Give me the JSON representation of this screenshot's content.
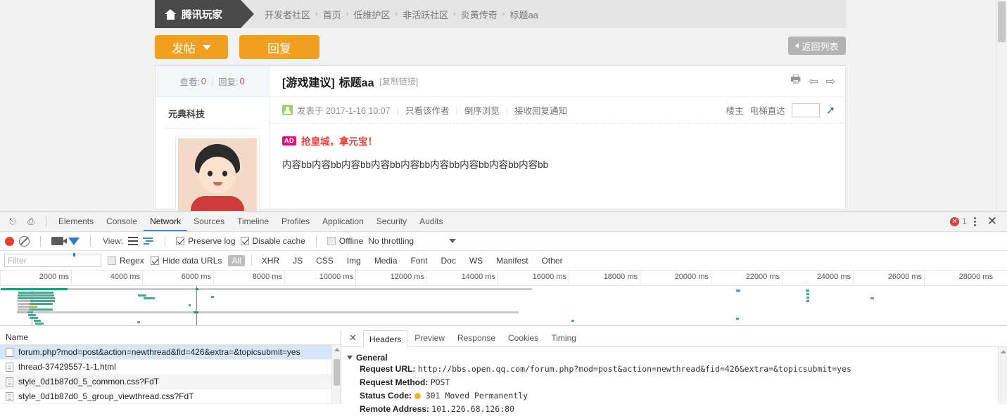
{
  "forum": {
    "brand": "腾讯玩家",
    "breadcrumb": [
      {
        "label": "开发者社区"
      },
      {
        "label": "首页"
      },
      {
        "label": "低维护区"
      },
      {
        "label": "非活跃社区"
      },
      {
        "label": "炎黄传奇"
      },
      {
        "label": "标题aa"
      }
    ],
    "buttons": {
      "post": "发帖",
      "reply": "回复",
      "back": "返回列表"
    },
    "stats": {
      "views_label": "查看:",
      "views_value": "0",
      "replies_label": "回复:",
      "replies_value": "0"
    },
    "author": "元典科技",
    "thread": {
      "category": "[游戏建议]",
      "title": "标题aa",
      "copy_link": "[复制链接]",
      "posted_at": "发表于 2017-1-16 10:07",
      "links": [
        "只看该作者",
        "倒序浏览",
        "接收回复通知"
      ],
      "floor_label": "楼主",
      "elevator_label": "电梯直达",
      "floor_value": "",
      "ad_badge": "AD",
      "ad_text": "抢皇城，拿元宝！",
      "content": "内容bb内容bb内容bb内容bb内容bb内容bb内容bb内容bb内容bb"
    },
    "icons": {
      "print": "print-icon",
      "prev": "prev-arrow-icon",
      "next": "next-arrow-icon",
      "jump": "jump-wrench-icon"
    }
  },
  "devtools": {
    "tabs": [
      "Elements",
      "Console",
      "Network",
      "Sources",
      "Timeline",
      "Profiles",
      "Application",
      "Security",
      "Audits"
    ],
    "active_tab": "Network",
    "error_count": "1",
    "toolbar": {
      "view_label": "View:",
      "preserve_log": "Preserve log",
      "preserve_log_checked": true,
      "disable_cache": "Disable cache",
      "disable_cache_checked": true,
      "offline": "Offline",
      "offline_checked": false,
      "throttling": "No throttling"
    },
    "filterbar": {
      "placeholder": "Filter",
      "value": "",
      "regex": "Regex",
      "regex_checked": false,
      "hide_data_urls": "Hide data URLs",
      "hide_data_urls_checked": true,
      "types": [
        "All",
        "XHR",
        "JS",
        "CSS",
        "Img",
        "Media",
        "Font",
        "Doc",
        "WS",
        "Manifest",
        "Other"
      ],
      "active_type": "All"
    },
    "timeline_ticks": [
      "2000 ms",
      "4000 ms",
      "6000 ms",
      "8000 ms",
      "10000 ms",
      "12000 ms",
      "14000 ms",
      "16000 ms",
      "18000 ms",
      "20000 ms",
      "22000 ms",
      "24000 ms",
      "26000 ms",
      "28000 ms"
    ],
    "requests": {
      "column_name": "Name",
      "rows": [
        {
          "name": "forum.php?mod=post&action=newthread&fid=426&extra=&topicsubmit=yes",
          "selected": true
        },
        {
          "name": "thread-37429557-1-1.html",
          "selected": false
        },
        {
          "name": "style_0d1b87d0_5_common.css?FdT",
          "selected": false
        },
        {
          "name": "style_0d1b87d0_5_group_viewthread.css?FdT",
          "selected": false
        }
      ]
    },
    "details": {
      "tabs": [
        "Headers",
        "Preview",
        "Response",
        "Cookies",
        "Timing"
      ],
      "active_tab": "Headers",
      "section_title": "General",
      "fields": [
        {
          "key": "Request URL:",
          "value": "http://bbs.open.qq.com/forum.php?mod=post&action=newthread&fid=426&extra=&topicsubmit=yes",
          "status": false
        },
        {
          "key": "Request Method:",
          "value": "POST",
          "status": false
        },
        {
          "key": "Status Code:",
          "value": "301 Moved Permanently",
          "status": true
        },
        {
          "key": "Remote Address:",
          "value": "101.226.68.126:80",
          "status": false
        }
      ]
    },
    "colors": {
      "accent": "#4285f4",
      "record": "#e83b34",
      "status": "#f0b429"
    }
  }
}
